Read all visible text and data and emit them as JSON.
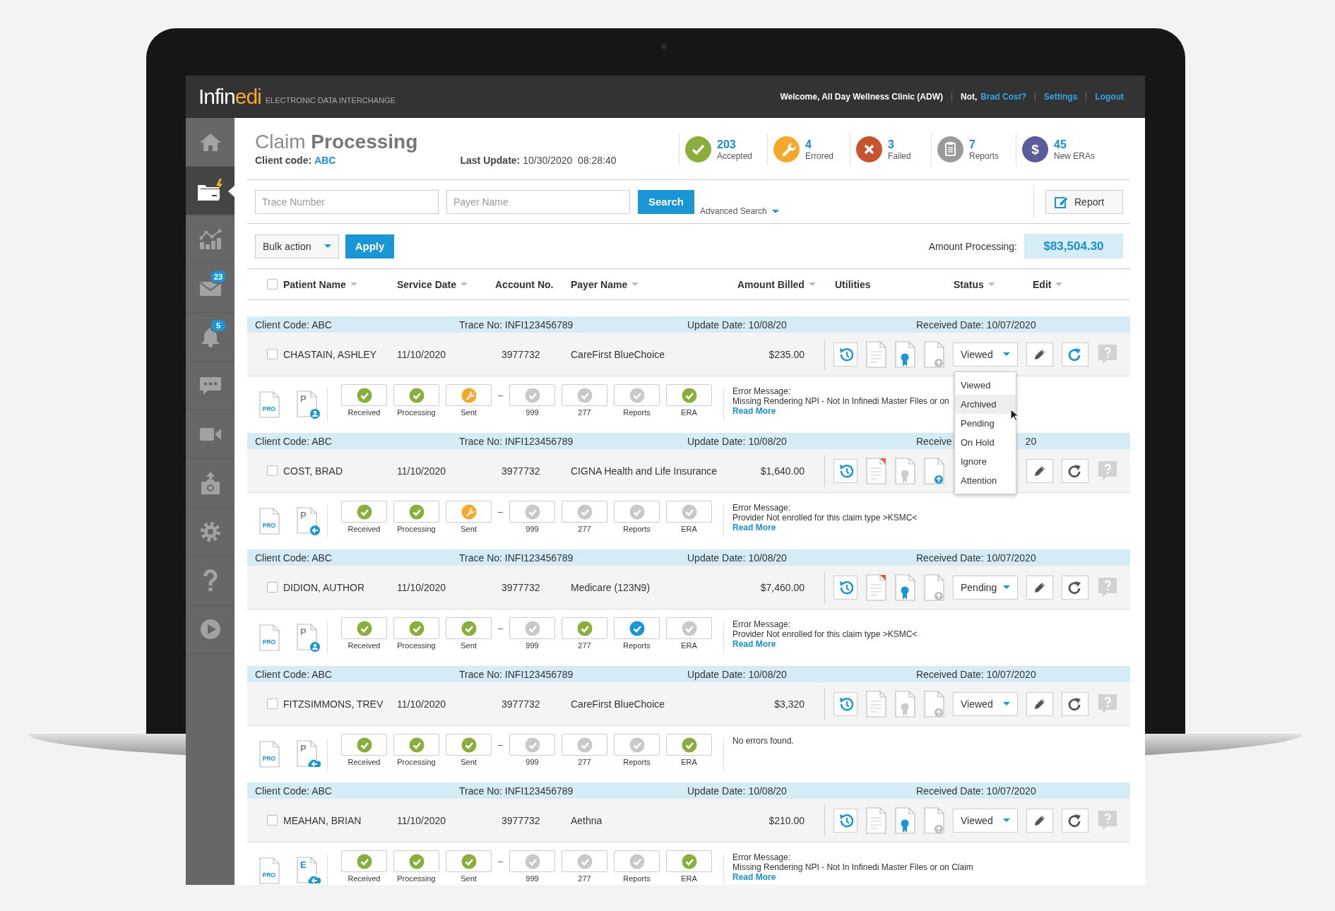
{
  "header": {
    "logo": [
      "Infin",
      "edi"
    ],
    "tagline": "ELECTRONIC DATA INTERCHANGE",
    "welcome": "Welcome, All Day Wellness Clinic (ADW)",
    "not_label": "Not,",
    "not_link": "Brad Cost?",
    "links": [
      "Settings",
      "Logout"
    ]
  },
  "sidebar": {
    "items": [
      {
        "kind": "home",
        "selected": false
      },
      {
        "kind": "claims",
        "selected": true
      },
      {
        "kind": "analytics",
        "selected": false
      },
      {
        "kind": "mail",
        "selected": false,
        "badge": "23"
      },
      {
        "kind": "alerts",
        "selected": false,
        "badge": "5"
      },
      {
        "kind": "chat",
        "selected": false
      },
      {
        "kind": "video",
        "selected": false
      },
      {
        "kind": "upload",
        "selected": false
      },
      {
        "kind": "settings",
        "selected": false
      },
      {
        "kind": "help",
        "selected": false
      },
      {
        "kind": "play",
        "selected": false
      }
    ]
  },
  "page": {
    "title": "Claim **Processing**",
    "client_code_label": "Client code:",
    "client_code": "ABC",
    "last_update_label": "Last Update:",
    "last_update": "10/30/2020  08:28:40"
  },
  "stats": [
    {
      "kind": "accepted",
      "value": "203",
      "label": "Accepted",
      "color": "#8aae3c"
    },
    {
      "kind": "errored",
      "value": "4",
      "label": "Errored",
      "color": "#f5a82c"
    },
    {
      "kind": "failed",
      "value": "3",
      "label": "Failed",
      "color": "#c9532f"
    },
    {
      "kind": "reports",
      "value": "7",
      "label": "Reports",
      "color": "#9a9a9a"
    },
    {
      "kind": "eras",
      "value": "45",
      "label": "New ERAs",
      "color": "#5b5b9c",
      "glyph": "$"
    }
  ],
  "search": {
    "fields": [
      {
        "placeholder": "Trace Number"
      },
      {
        "placeholder": "Payer Name"
      }
    ],
    "button": "Search",
    "advanced": "Advanced Search",
    "report": "Report"
  },
  "bulk": {
    "select": "Bulk action",
    "apply": "Apply",
    "amount_label": "Amount Processing:",
    "amount": "$83,504.30"
  },
  "table": {
    "select_all_checked": false,
    "columns": [
      {
        "label": "Patient Name",
        "sortable": true
      },
      {
        "label": "Service Date",
        "sortable": true
      },
      {
        "label": "Account No.",
        "sortable": false
      },
      {
        "label": "Payer Name",
        "sortable": true
      },
      {
        "label": "Amount Billed",
        "sortable": true
      },
      {
        "label": "Utilities",
        "sortable": false
      },
      {
        "label": "Status",
        "sortable": true
      },
      {
        "label": "Edit",
        "sortable": true
      }
    ]
  },
  "claims": [
    {
      "client_code": "Client Code: ABC",
      "trace": "Trace No: INFI123456789",
      "update": "Update Date: 10/08/20",
      "received": [
        "Received Date: 10/07/2020"
      ],
      "checked": false,
      "patient": "CHASTAIN, ASHLEY",
      "service_date": "11/10/2020",
      "account": "3977732",
      "payer": "CareFirst BlueChoice",
      "amount": "$235.00",
      "flagged": false,
      "certified": true,
      "uploaded": false,
      "status": "Viewed",
      "refresh_active": true,
      "form": "PRO",
      "source": {
        "letter": "P",
        "kind": "person"
      },
      "steps": [
        {
          "label": "Received",
          "kind": "done"
        },
        {
          "label": "Processing",
          "kind": "done"
        },
        {
          "label": "Sent",
          "kind": "warning"
        },
        {
          "label": "–",
          "kind": "separator"
        },
        {
          "label": "999",
          "kind": "pending"
        },
        {
          "label": "277",
          "kind": "pending"
        },
        {
          "label": "Reports",
          "kind": "pending"
        },
        {
          "label": "ERA",
          "kind": "done"
        }
      ],
      "message": {
        "title": "Error Message:",
        "text": "Missing Rendering NPI - Not In Infinedi Master Files or on",
        "link": "Read More"
      },
      "menu": {
        "items": [
          {
            "label": "Viewed",
            "hovered": false
          },
          {
            "label": "Archived",
            "hovered": true
          },
          {
            "label": "Pending",
            "hovered": false
          },
          {
            "label": "On Hold",
            "hovered": false
          },
          {
            "label": "Ignore",
            "hovered": false
          },
          {
            "label": "Attention",
            "hovered": false
          }
        ]
      }
    },
    {
      "client_code": "Client Code: ABC",
      "trace": "Trace No: INFI123456789",
      "update": "Update Date: 10/08/20",
      "received": [
        "Receive",
        "20"
      ],
      "checked": false,
      "patient": "COST, BRAD",
      "service_date": "11/10/2020",
      "account": "3977732",
      "payer": "CIGNA Health and Life Insurance",
      "amount": "$1,640.00",
      "flagged": true,
      "certified": false,
      "uploaded": true,
      "refresh_active": false,
      "form": "PRO",
      "source": {
        "letter": "P",
        "kind": "arrow"
      },
      "steps": [
        {
          "label": "Received",
          "kind": "done"
        },
        {
          "label": "Processing",
          "kind": "done"
        },
        {
          "label": "Sent",
          "kind": "warning"
        },
        {
          "label": "–",
          "kind": "separator"
        },
        {
          "label": "999",
          "kind": "pending"
        },
        {
          "label": "277",
          "kind": "pending"
        },
        {
          "label": "Reports",
          "kind": "pending"
        },
        {
          "label": "ERA",
          "kind": "pending"
        }
      ],
      "message": {
        "title": "Error Message:",
        "text": "Provider Not enrolled for this claim type >KSMC<",
        "link": "Read More"
      }
    },
    {
      "client_code": "Client Code: ABC",
      "trace": "Trace No: INFI123456789",
      "update": "Update Date: 10/08/20",
      "received": [
        "Received Date: 10/07/2020"
      ],
      "checked": false,
      "patient": "DIDION, AUTHOR",
      "service_date": "11/10/2020",
      "account": "3977732",
      "payer": "Medicare (123N9)",
      "amount": "$7,460.00",
      "flagged": true,
      "certified": true,
      "uploaded": false,
      "status": "Pending",
      "refresh_active": false,
      "form": "PRO",
      "source": {
        "letter": "P",
        "kind": "person"
      },
      "steps": [
        {
          "label": "Received",
          "kind": "done"
        },
        {
          "label": "Processing",
          "kind": "done"
        },
        {
          "label": "Sent",
          "kind": "done"
        },
        {
          "label": "–",
          "kind": "separator"
        },
        {
          "label": "999",
          "kind": "pending"
        },
        {
          "label": "277",
          "kind": "done"
        },
        {
          "label": "Reports",
          "kind": "active"
        },
        {
          "label": "ERA",
          "kind": "pending"
        }
      ],
      "message": {
        "title": "Error Message:",
        "text": "Provider Not enrolled for this claim type >KSMC<",
        "link": "Read More"
      }
    },
    {
      "client_code": "Client Code: ABC",
      "trace": "Trace No: INFI123456789",
      "update": "Update Date: 10/08/20",
      "received": [
        "Received Date: 10/07/2020"
      ],
      "checked": false,
      "patient": "FITZSIMMONS, TREV",
      "service_date": "11/10/2020",
      "account": "3977732",
      "payer": "CareFirst BlueChoice",
      "amount": "$3,320",
      "flagged": false,
      "certified": false,
      "uploaded": false,
      "status": "Viewed",
      "refresh_active": false,
      "form": "PRO",
      "source": {
        "letter": "P",
        "kind": "cloud"
      },
      "steps": [
        {
          "label": "Received",
          "kind": "done"
        },
        {
          "label": "Processing",
          "kind": "done"
        },
        {
          "label": "Sent",
          "kind": "done"
        },
        {
          "label": "–",
          "kind": "separator"
        },
        {
          "label": "999",
          "kind": "pending"
        },
        {
          "label": "277",
          "kind": "pending"
        },
        {
          "label": "Reports",
          "kind": "pending"
        },
        {
          "label": "ERA",
          "kind": "done"
        }
      ],
      "message": {
        "text": "No errors found."
      }
    },
    {
      "client_code": "Client Code: ABC",
      "trace": "Trace No: INFI123456789",
      "update": "Update Date: 10/08/20",
      "received": [
        "Received Date: 10/07/2020"
      ],
      "checked": false,
      "patient": "MEAHAN, BRIAN",
      "service_date": "11/10/2020",
      "account": "3977732",
      "payer": "Aethna",
      "amount": "$210.00",
      "flagged": false,
      "certified": true,
      "uploaded": false,
      "status": "Viewed",
      "refresh_active": false,
      "form": "PRO",
      "source": {
        "letter": "E",
        "kind": "cloud"
      },
      "steps": [
        {
          "label": "Received",
          "kind": "done"
        },
        {
          "label": "Processing",
          "kind": "done"
        },
        {
          "label": "Sent",
          "kind": "done"
        },
        {
          "label": "–",
          "kind": "separator"
        },
        {
          "label": "999",
          "kind": "pending"
        },
        {
          "label": "277",
          "kind": "pending"
        },
        {
          "label": "Reports",
          "kind": "pending"
        },
        {
          "label": "ERA",
          "kind": "done"
        }
      ],
      "message": {
        "title": "Error Message:",
        "text": "Missing Rendering NPI - Not In Infinedi Master Files or on Claim",
        "link": "Read More"
      }
    }
  ]
}
